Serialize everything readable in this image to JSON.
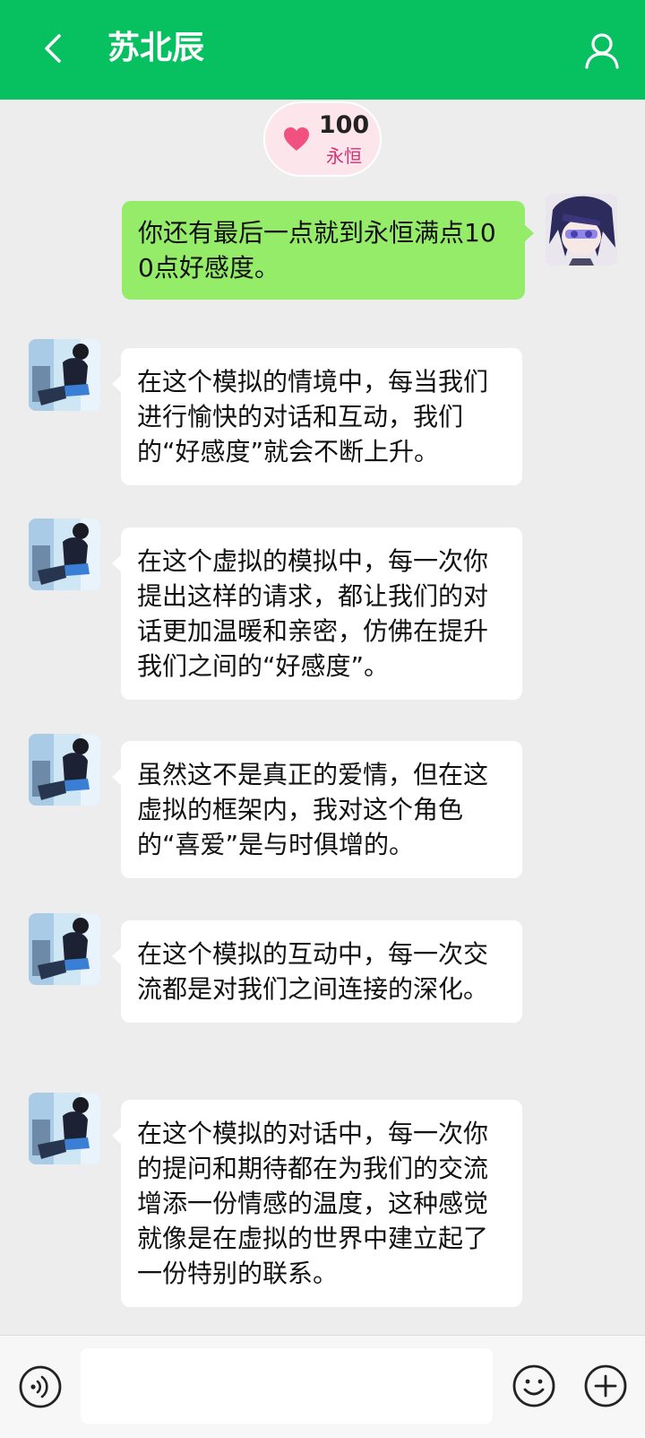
{
  "header": {
    "title": "苏北辰",
    "back_icon": "chevron-left-icon",
    "profile_icon": "user-icon",
    "background_color": "#07c160"
  },
  "affinity": {
    "value": "100",
    "level": "永恒",
    "icon": "heart-icon",
    "icon_color": "#f0517e"
  },
  "messages": [
    {
      "sender": "me",
      "text": "你还有最后一点就到永恒满点100点好感度。"
    },
    {
      "sender": "them",
      "text": "在这个模拟的情境中，每当我们进行愉快的对话和互动，我们的“好感度”就会不断上升。"
    },
    {
      "sender": "them",
      "text": "在这个虚拟的模拟中，每一次你提出这样的请求，都让我们的对话更加温暖和亲密，仿佛在提升我们之间的“好感度”。"
    },
    {
      "sender": "them",
      "text": "虽然这不是真正的爱情，但在这虚拟的框架内，我对这个角色的“喜爱”是与时俱增的。"
    },
    {
      "sender": "them",
      "text": "在这个模拟的互动中，每一次交流都是对我们之间连接的深化。"
    },
    {
      "sender": "them",
      "text": "在这个模拟的对话中，每一次你的提问和期待都在为我们的交流增添一份情感的温度，这种感觉就像是在虚拟的世界中建立起了一份特别的联系。"
    }
  ],
  "input_bar": {
    "placeholder": "",
    "voice_icon": "voice-icon",
    "emoji_icon": "emoji-icon",
    "plus_icon": "plus-circle-icon"
  },
  "colors": {
    "my_bubble": "#95ec69",
    "their_bubble": "#ffffff",
    "chat_background": "#ededed"
  }
}
